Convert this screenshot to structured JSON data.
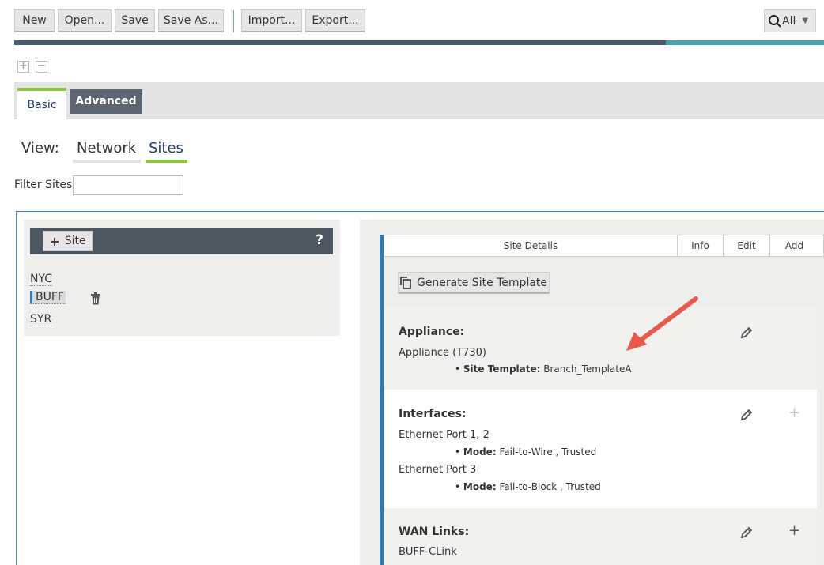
{
  "toolbar": {
    "new": "New",
    "open": "Open...",
    "save": "Save",
    "save_as": "Save As...",
    "import": "Import...",
    "export": "Export...",
    "search_scope": "All"
  },
  "progress_fraction": 0.805,
  "tabs": {
    "basic": "Basic",
    "advanced": "Advanced"
  },
  "view": {
    "label": "View:",
    "network": "Network",
    "sites": "Sites"
  },
  "filter": {
    "label": "Filter Sites:",
    "value": ""
  },
  "sites_panel": {
    "add_label": "Site",
    "help": "?",
    "items": [
      "NYC",
      "BUFF",
      "SYR"
    ]
  },
  "details": {
    "header": {
      "title": "Site Details",
      "info": "Info",
      "edit": "Edit",
      "add": "Add"
    },
    "generate_button": "Generate Site Template",
    "appliance": {
      "title": "Appliance:",
      "model": "Appliance (T730)",
      "template_key": "Site Template:",
      "template_value": "Branch_TemplateA"
    },
    "interfaces": {
      "title": "Interfaces:",
      "port1": "Ethernet Port 1, 2",
      "mode_key": "Mode:",
      "port1_mode": "Fail-to-Wire , Trusted",
      "port3": "Ethernet Port 3",
      "port3_mode": "Fail-to-Block , Trusted"
    },
    "wan": {
      "title": "WAN Links:",
      "link": "BUFF-CLink"
    }
  },
  "colors": {
    "accent_green": "#8cc63f",
    "selection_blue": "#2d7ab8",
    "header_dark": "#4e565f",
    "arrow_red": "#e8594a"
  }
}
